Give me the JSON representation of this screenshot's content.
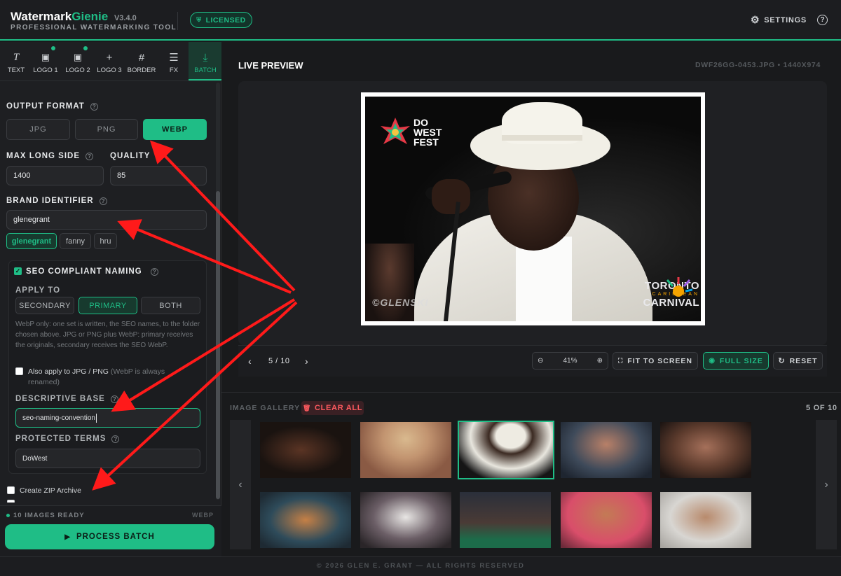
{
  "app": {
    "name_part1": "Watermark",
    "name_part2": "Gienie",
    "version": "V3.4.0",
    "tagline": "PROFESSIONAL WATERMARKING TOOL",
    "license_badge": "LICENSED",
    "settings_label": "SETTINGS",
    "help_label": "?"
  },
  "tools": [
    {
      "label": "TEXT",
      "icon": "text-tool-icon",
      "glyph": "T"
    },
    {
      "label": "LOGO 1",
      "icon": "logo1-icon",
      "glyph": "▣"
    },
    {
      "label": "LOGO 2",
      "icon": "logo2-icon",
      "glyph": "▣"
    },
    {
      "label": "LOGO 3",
      "icon": "plus-icon",
      "glyph": "+"
    },
    {
      "label": "BORDER",
      "icon": "grid-icon",
      "glyph": "#"
    },
    {
      "label": "FX",
      "icon": "sliders-icon",
      "glyph": "☰"
    },
    {
      "label": "BATCH",
      "icon": "download-icon",
      "glyph": "⤓"
    }
  ],
  "batch": {
    "output_format_label": "OUTPUT FORMAT",
    "formats": [
      "JPG",
      "PNG",
      "WEBP"
    ],
    "selected_format": "WEBP",
    "max_long_side_label": "MAX LONG SIDE",
    "max_long_side_value": "1400",
    "quality_label": "QUALITY",
    "quality_value": "85",
    "brand_identifier_label": "BRAND IDENTIFIER",
    "brand_identifier_value": "glenegrant",
    "brand_chips": [
      "glenegrant",
      "fanny",
      "hru"
    ],
    "seo_label": "SEO COMPLIANT NAMING",
    "apply_to_label": "APPLY TO",
    "apply_to_options": [
      "SECONDARY",
      "PRIMARY",
      "BOTH"
    ],
    "apply_to_selected": "PRIMARY",
    "seo_description": "WebP only: one set is written, the SEO names, to the folder chosen above. JPG or PNG plus WebP: primary receives the originals, secondary receives the SEO WebP.",
    "also_apply_label": "Also apply to JPG / PNG",
    "also_apply_note": "(WebP is always renamed)",
    "descriptive_base_label": "DESCRIPTIVE BASE",
    "descriptive_base_value": "seo-naming-convention",
    "protected_terms_label": "PROTECTED TERMS",
    "protected_terms_value": "DoWest",
    "zip_label": "Create ZIP Archive",
    "ready_text": "10 IMAGES READY",
    "ready_format": "WEBP",
    "process_label": "PROCESS BATCH"
  },
  "preview": {
    "title": "LIVE PREVIEW",
    "file_info": "DWF26GG-0453.JPG • 1440X974",
    "logo_left_line1": "DO",
    "logo_left_line2": "WEST",
    "logo_left_line3": "FEST",
    "logo_right_line1": "TORONTO",
    "logo_right_line2": "CARIBBEAN",
    "logo_right_line3": "CARNIVAL",
    "watermark_text": "©GLENSKI",
    "page_indicator": "5 / 10",
    "zoom": "41%",
    "fit_label": "FIT TO SCREEN",
    "full_label": "FULL SIZE",
    "reset_label": "RESET"
  },
  "gallery": {
    "title": "IMAGE GALLERY",
    "clear_label": "CLEAR ALL",
    "count": "5 OF 10"
  },
  "footer": "© 2026 GLEN E. GRANT — ALL RIGHTS RESERVED",
  "colors": {
    "accent": "#1fbd86",
    "arrow": "#ff1a1a"
  }
}
